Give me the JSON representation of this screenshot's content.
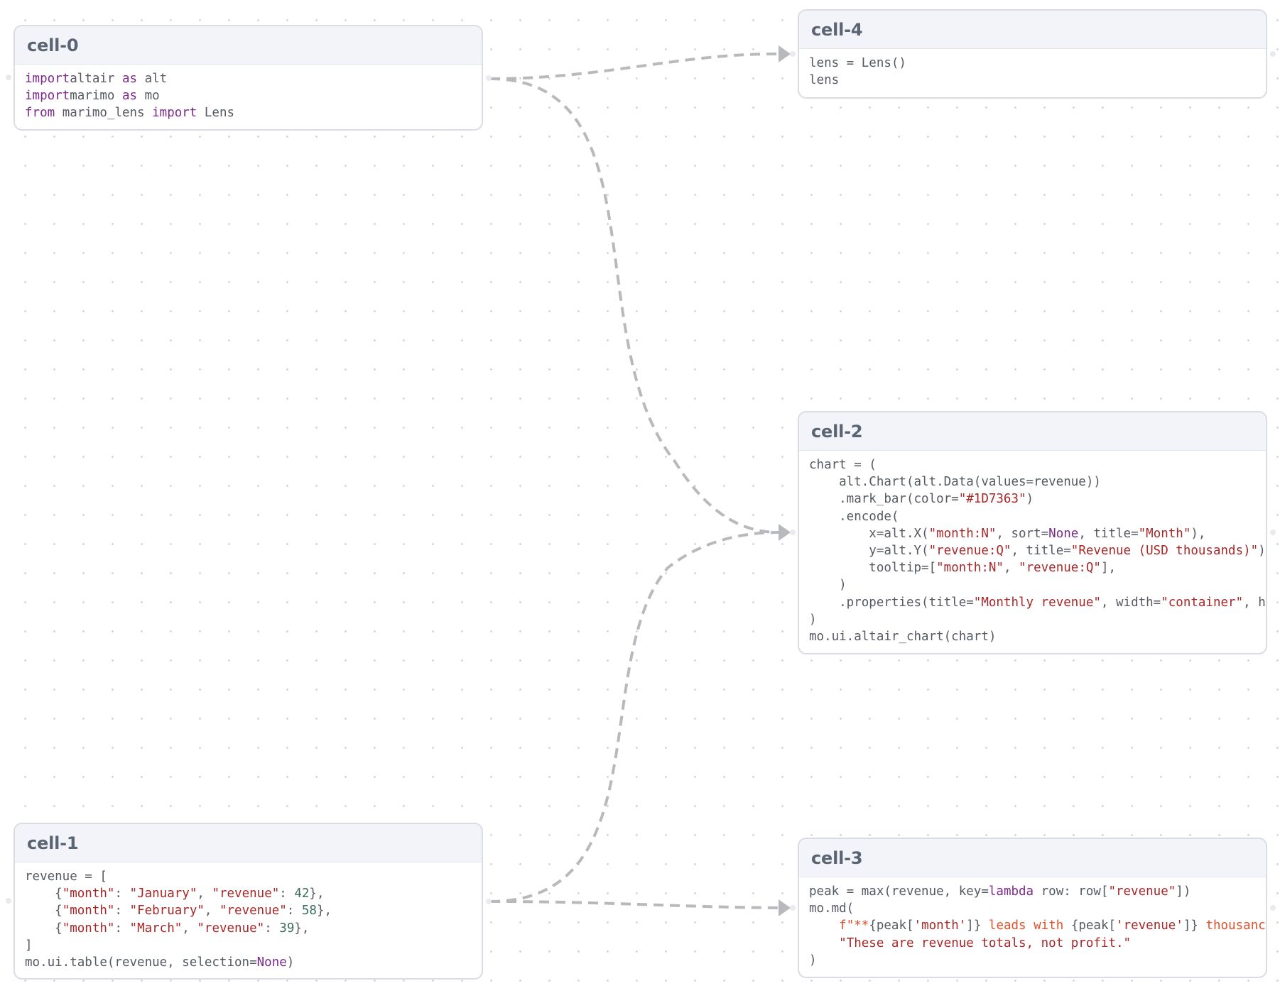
{
  "colors": {
    "keyword": "#7b2a8a",
    "string": "#a72828",
    "number": "#3b6e5a",
    "fstring": "#e0502a",
    "identifier": "#555a61",
    "edge": "#b8b9bc"
  },
  "cells": [
    {
      "title": "cell-0",
      "lines": [
        [
          [
            "kw",
            "import"
          ],
          [
            "",
            "altair "
          ],
          [
            "kw",
            "as"
          ],
          [
            "",
            " alt"
          ]
        ],
        [
          [
            "kw",
            "import"
          ],
          [
            "",
            "marimo "
          ],
          [
            "kw",
            "as"
          ],
          [
            "",
            " mo"
          ]
        ],
        [
          [
            "kw",
            "from"
          ],
          [
            "",
            " marimo_lens "
          ],
          [
            "kw",
            "import"
          ],
          [
            "",
            " Lens"
          ]
        ]
      ]
    },
    {
      "title": "cell-4",
      "lines": [
        [
          [
            "",
            "lens = Lens()"
          ]
        ],
        [
          [
            "",
            "lens"
          ]
        ]
      ]
    },
    {
      "title": "cell-2",
      "lines": [
        [
          [
            "",
            "chart = ("
          ]
        ],
        [
          [
            "",
            "    alt.Chart(alt.Data(values=revenue))"
          ]
        ],
        [
          [
            "",
            "    .mark_bar(color="
          ],
          [
            "str",
            "\"#1D7363\""
          ],
          [
            "",
            ")"
          ]
        ],
        [
          [
            "",
            "    .encode("
          ]
        ],
        [
          [
            "",
            "        x=alt.X("
          ],
          [
            "str",
            "\"month:N\""
          ],
          [
            "",
            ", sort="
          ],
          [
            "kw",
            "None"
          ],
          [
            "",
            ", title="
          ],
          [
            "str",
            "\"Month\""
          ],
          [
            "",
            "),"
          ]
        ],
        [
          [
            "",
            "        y=alt.Y("
          ],
          [
            "str",
            "\"revenue:Q\""
          ],
          [
            "",
            ", title="
          ],
          [
            "str",
            "\"Revenue (USD thousands)\""
          ],
          [
            "",
            ")"
          ]
        ],
        [
          [
            "",
            "        tooltip=["
          ],
          [
            "str",
            "\"month:N\""
          ],
          [
            "",
            ", "
          ],
          [
            "str",
            "\"revenue:Q\""
          ],
          [
            "",
            "],"
          ]
        ],
        [
          [
            "",
            "    )"
          ]
        ],
        [
          [
            "",
            "    .properties(title="
          ],
          [
            "str",
            "\"Monthly revenue\""
          ],
          [
            "",
            ", width="
          ],
          [
            "str",
            "\"container\""
          ],
          [
            "",
            ", h"
          ]
        ],
        [
          [
            "",
            ")"
          ]
        ],
        [
          [
            "",
            "mo.ui.altair_chart(chart)"
          ]
        ]
      ]
    },
    {
      "title": "cell-1",
      "lines": [
        [
          [
            "",
            "revenue = ["
          ]
        ],
        [
          [
            "",
            "    {"
          ],
          [
            "str",
            "\"month\""
          ],
          [
            "",
            ": "
          ],
          [
            "str",
            "\"January\""
          ],
          [
            "",
            ", "
          ],
          [
            "str",
            "\"revenue\""
          ],
          [
            "",
            ": "
          ],
          [
            "num",
            "42"
          ],
          [
            "",
            "},"
          ]
        ],
        [
          [
            "",
            "    {"
          ],
          [
            "str",
            "\"month\""
          ],
          [
            "",
            ": "
          ],
          [
            "str",
            "\"February\""
          ],
          [
            "",
            ", "
          ],
          [
            "str",
            "\"revenue\""
          ],
          [
            "",
            ": "
          ],
          [
            "num",
            "58"
          ],
          [
            "",
            "},"
          ]
        ],
        [
          [
            "",
            "    {"
          ],
          [
            "str",
            "\"month\""
          ],
          [
            "",
            ": "
          ],
          [
            "str",
            "\"March\""
          ],
          [
            "",
            ", "
          ],
          [
            "str",
            "\"revenue\""
          ],
          [
            "",
            ": "
          ],
          [
            "num",
            "39"
          ],
          [
            "",
            "},"
          ]
        ],
        [
          [
            "",
            "]"
          ]
        ],
        [
          [
            "",
            "mo.ui.table(revenue, selection="
          ],
          [
            "kw",
            "None"
          ],
          [
            "",
            ")"
          ]
        ]
      ]
    },
    {
      "title": "cell-3",
      "lines": [
        [
          [
            "",
            "peak = max(revenue, key="
          ],
          [
            "kw",
            "lambda"
          ],
          [
            "",
            " row: row["
          ],
          [
            "str",
            "\"revenue\""
          ],
          [
            "",
            "])"
          ]
        ],
        [
          [
            "",
            "mo.md("
          ]
        ],
        [
          [
            "",
            "    "
          ],
          [
            "fstr",
            "f\"**"
          ],
          [
            "",
            "{peak["
          ],
          [
            "str",
            "'month'"
          ],
          [
            "",
            "]}"
          ],
          [
            "fstr",
            " leads with "
          ],
          [
            "",
            "{peak["
          ],
          [
            "str",
            "'revenue'"
          ],
          [
            "",
            "]}"
          ],
          [
            "fstr",
            " thousanc"
          ]
        ],
        [
          [
            "",
            "    "
          ],
          [
            "str",
            "\"These are revenue totals, not profit.\""
          ]
        ],
        [
          [
            "",
            ")"
          ]
        ]
      ]
    }
  ],
  "edges": [
    {
      "from": "cell-0",
      "to": "cell-4"
    },
    {
      "from": "cell-0",
      "to": "cell-2"
    },
    {
      "from": "cell-1",
      "to": "cell-2"
    },
    {
      "from": "cell-1",
      "to": "cell-3"
    }
  ]
}
